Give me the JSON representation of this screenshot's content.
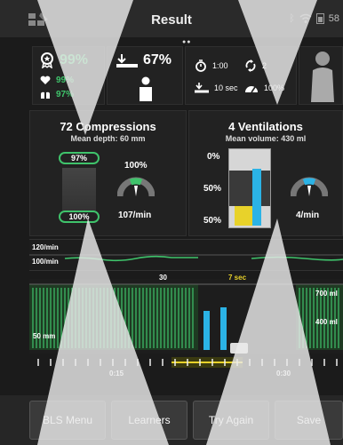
{
  "header": {
    "title": "Result",
    "pager": "●●",
    "battery": "58"
  },
  "score": {
    "overall": "99%",
    "flow": "99%",
    "ventilation": "97%"
  },
  "depth_score": {
    "percent": "67%"
  },
  "timing": {
    "duration": "1:00",
    "cycles": "2",
    "hands_off": "10 sec",
    "release": "100%"
  },
  "compressions": {
    "title": "72 Compressions",
    "subtitle": "Mean depth: 60 mm",
    "depth_ok": "97%",
    "rate_ok": "100%",
    "recoil": "100%",
    "rate": "107/min"
  },
  "ventilations": {
    "title": "4 Ventilations",
    "subtitle": "Mean volume: 430 ml",
    "low": "0%",
    "ok": "50%",
    "high": "50%",
    "rate": "4/min"
  },
  "rate_band": {
    "high": "120/min",
    "low": "100/min"
  },
  "graph": {
    "marker_30": "30",
    "marker_7sec": "7 sec",
    "depth_50": "50 mm",
    "vol_700": "700 ml",
    "vol_400": "400 ml"
  },
  "timeline": {
    "t15": "0:15",
    "t30": "0:30"
  },
  "buttons": {
    "bls_menu": "BLS Menu",
    "learners": "Learners",
    "try_again": "Try Again",
    "save": "Save"
  },
  "colors": {
    "green": "#3fc36b",
    "yellow": "#e8d22a",
    "cyan": "#2bb3e6",
    "panel": "#222222"
  }
}
